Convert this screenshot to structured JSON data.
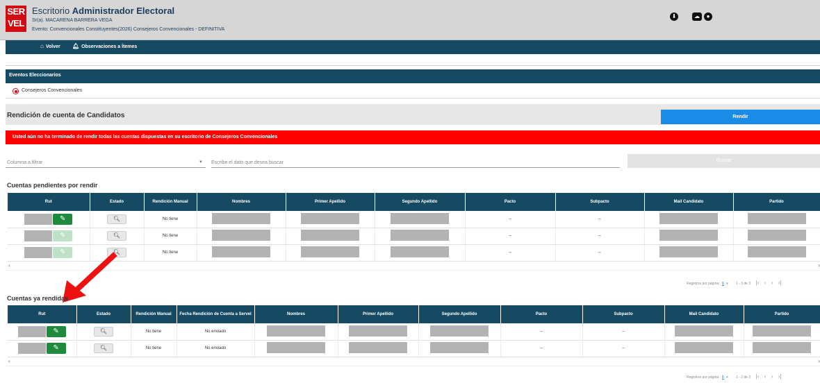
{
  "header": {
    "logo_top": "SER",
    "logo_bottom": "VEL",
    "title_prefix": "Escritorio ",
    "title_bold": "Administrador Electoral",
    "user": "Sr(a). MACARENA BARRERA VEGA",
    "event": "Evento: Convencionales Constituyentes(2026) Consejeros Convencionales - DEFINITIVA"
  },
  "nav": {
    "back": "Volver",
    "observations": "Observaciones a Ítemes"
  },
  "events": {
    "title": "Eventos Eleccionarios",
    "option": "Consejeros Convencionales"
  },
  "rendicion": {
    "title": "Rendición de cuenta de Candidatos",
    "button": "Rendir"
  },
  "alert": "Usted aún no ha terminado de rendir todas las cuentas dispuestas en su escritorio de Consejeros Convencionales",
  "filter": {
    "column_placeholder": "Columna a filtrar",
    "search_placeholder": "Escribe el dato que desea buscar",
    "button": "Buscar"
  },
  "pending": {
    "title": "Cuentas pendientes por rendir",
    "headers": [
      "Rut",
      "Estado",
      "Rendición Manual",
      "Nombres",
      "Primer Apellido",
      "Segundo Apellido",
      "Pacto",
      "Subpacto",
      "Mail Candidato",
      "Partido"
    ],
    "rows": [
      {
        "manual": "No tiene",
        "pacto": "–",
        "subpacto": "–",
        "edit_enabled": true
      },
      {
        "manual": "No tiene",
        "pacto": "–",
        "subpacto": "–",
        "edit_enabled": false
      },
      {
        "manual": "No tiene",
        "pacto": "–",
        "subpacto": "–",
        "edit_enabled": false
      }
    ],
    "pager": {
      "label": "Registros por página:",
      "size": "8",
      "range": "1 - 3 de 3"
    }
  },
  "done": {
    "title": "Cuentas ya rendidas",
    "headers": [
      "Rut",
      "Estado",
      "Rendición Manual",
      "Fecha Rendición de Cuenta a Servel",
      "Nombres",
      "Primer Apellido",
      "Segundo Apellido",
      "Pacto",
      "Subpacto",
      "Mail Candidato",
      "Partido"
    ],
    "rows": [
      {
        "manual": "No tiene",
        "fecha": "No enviado",
        "pacto": "–",
        "subpacto": "–"
      },
      {
        "manual": "No tiene",
        "fecha": "No enviado",
        "pacto": "–",
        "subpacto": "–"
      }
    ],
    "pager": {
      "label": "Registros por página:",
      "size": "8",
      "range": "1 - 2 de 2"
    }
  },
  "colors": {
    "primary": "#164a63",
    "alert": "#ff0000",
    "action": "#1a8ce8",
    "edit": "#1e8a3c",
    "logo": "#d20a11"
  }
}
